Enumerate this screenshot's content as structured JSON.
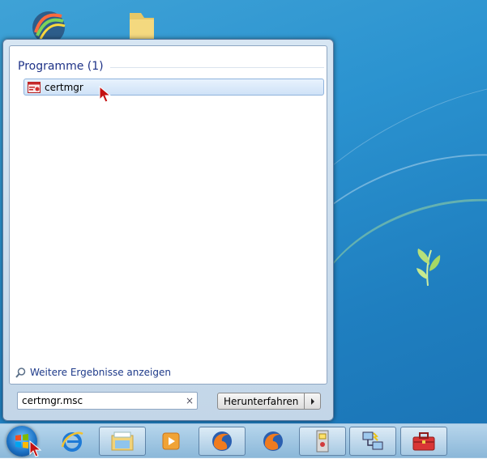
{
  "start_menu": {
    "section_title": "Programme (1)",
    "results": [
      {
        "label": "certmgr",
        "icon": "certificate-manager-icon"
      }
    ],
    "more_results_label": "Weitere Ergebnisse anzeigen",
    "search": {
      "value": "certmgr.msc",
      "clear_symbol": "×"
    },
    "shutdown_label": "Herunterfahren"
  },
  "taskbar": {
    "items": [
      {
        "name": "internet-explorer",
        "icon": "internet-explorer-icon"
      },
      {
        "name": "windows-explorer",
        "icon": "folder-explorer-icon"
      },
      {
        "name": "media-player",
        "icon": "media-player-icon"
      },
      {
        "name": "firefox-1",
        "icon": "firefox-icon"
      },
      {
        "name": "firefox-2",
        "icon": "firefox-icon"
      },
      {
        "name": "app-tool",
        "icon": "device-tool-icon"
      },
      {
        "name": "network-tool",
        "icon": "network-computers-icon"
      },
      {
        "name": "toolbox",
        "icon": "toolbox-icon"
      }
    ]
  },
  "colors": {
    "section_title": "#1e3287",
    "link": "#1e3a8a",
    "highlight": "#cfe2f7",
    "desktop": "#2b93d0"
  }
}
